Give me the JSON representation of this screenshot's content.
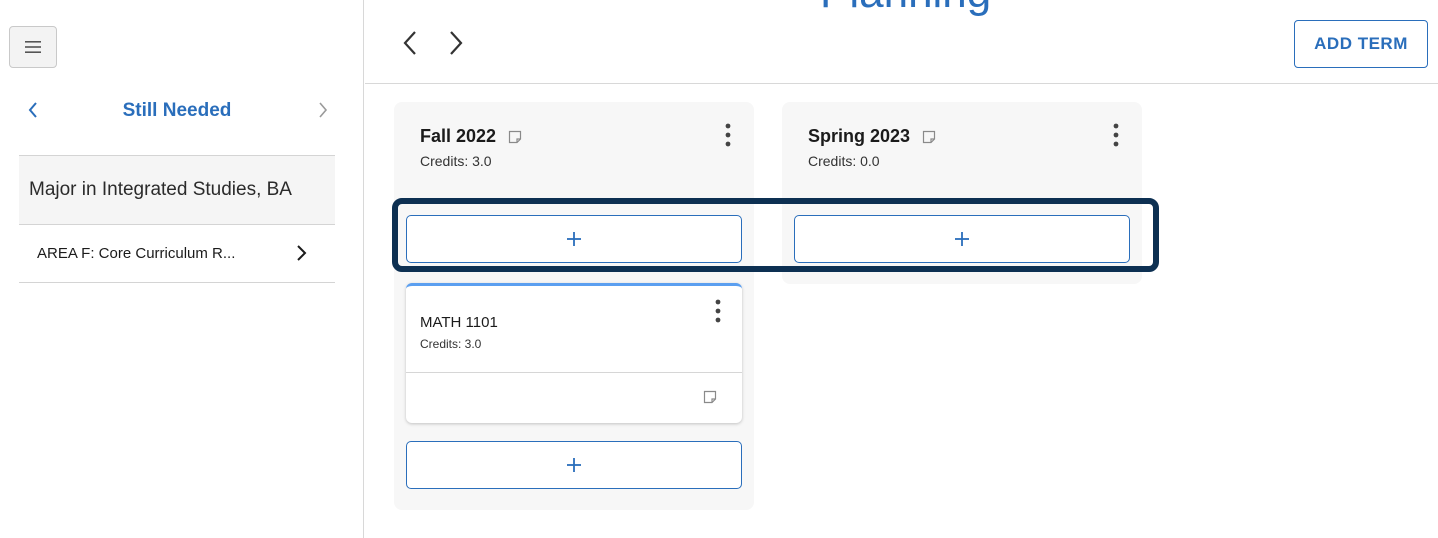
{
  "header": {
    "cropped_title": "Planning"
  },
  "sidebar": {
    "nav_title": "Still Needed",
    "group": "Major in Integrated Studies, BA",
    "requirement": "AREA F: Core Curriculum R..."
  },
  "toolbar": {
    "add_term_label": "ADD TERM"
  },
  "terms": [
    {
      "name": "Fall 2022",
      "credits": "Credits:  3.0"
    },
    {
      "name": "Spring 2023",
      "credits": "Credits:  0.0"
    }
  ],
  "course": {
    "title": "MATH 1101",
    "credits": "Credits: 3.0"
  },
  "colors": {
    "accent": "#2a6ebb",
    "highlight": "#0d3052",
    "card_top": "#5b9ff0"
  },
  "icons": [
    "hamburger-icon",
    "chevron-left-icon",
    "chevron-right-icon",
    "note-icon",
    "kebab-icon",
    "plus-icon"
  ]
}
